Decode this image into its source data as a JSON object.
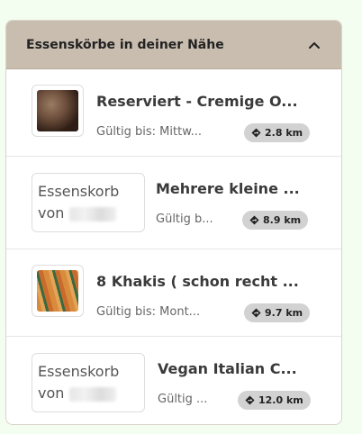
{
  "panel": {
    "title": "Essenskörbe in deiner Nähe",
    "collapse_icon": "chevron-up-icon"
  },
  "items": [
    {
      "thumb_type": "image",
      "title": "Reserviert - Cremige O...",
      "valid": "Gültig bis: Mittw...",
      "distance": "2.8 km",
      "icon": "direction-icon"
    },
    {
      "thumb_type": "text",
      "thumb_line1": "Essenskorb",
      "thumb_line2": "von",
      "title": "Mehrere kleine ...",
      "valid": "Gültig b...",
      "distance": "8.9 km",
      "icon": "direction-icon"
    },
    {
      "thumb_type": "image",
      "title": "8 Khakis ( schon recht ...",
      "valid": "Gültig bis: Mont...",
      "distance": "9.7 km",
      "icon": "direction-icon"
    },
    {
      "thumb_type": "text",
      "thumb_line1": "Essenskorb",
      "thumb_line2": "von",
      "title": "Vegan Italian C...",
      "valid": "Gültig ...",
      "distance": "12.0 km",
      "icon": "direction-icon"
    }
  ]
}
